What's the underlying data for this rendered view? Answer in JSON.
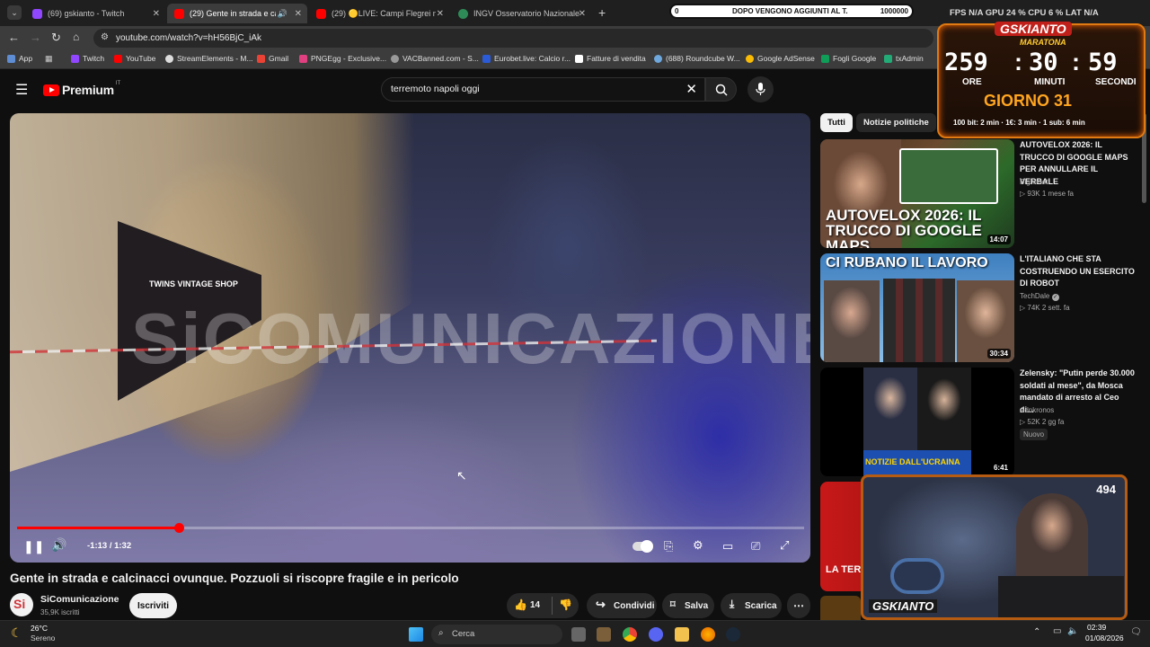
{
  "browser": {
    "tabs": [
      {
        "label": "(69) gskianto - Twitch",
        "color": "#9146ff",
        "active": false
      },
      {
        "label": "(29) Gente in strada e calcin",
        "color": "#ff0000",
        "active": true
      },
      {
        "label": "(29) 🟡LIVE: Campi Flegrei mo",
        "color": "#ff0000",
        "active": false
      },
      {
        "label": "INGV Osservatorio Nazionale Te",
        "color": "#2e8b57",
        "active": false
      }
    ],
    "new_tab": "+",
    "url": "youtube.com/watch?v=hH56BjC_iAk",
    "bookmarks": [
      {
        "label": "App",
        "color": "#5f8dd3"
      },
      {
        "label": "Twitch",
        "color": "#9146ff"
      },
      {
        "label": "YouTube",
        "color": "#ff0000"
      },
      {
        "label": "StreamElements - M...",
        "color": "#dddddd"
      },
      {
        "label": "Gmail",
        "color": "#ea4335"
      },
      {
        "label": "PNGEgg - Exclusive...",
        "color": "#e04080"
      },
      {
        "label": "VACBanned.com - S...",
        "color": "#999999"
      },
      {
        "label": "Eurobet.live: Calcio r...",
        "color": "#2b5bd7"
      },
      {
        "label": "Fatture di vendita",
        "color": "#ffffff"
      },
      {
        "label": "(688) Roundcube W...",
        "color": "#6fa8dc"
      },
      {
        "label": "Google AdSense",
        "color": "#fbbc05"
      },
      {
        "label": "Fogli Google",
        "color": "#0f9d58"
      },
      {
        "label": "txAdmin",
        "color": "#22aa77"
      }
    ]
  },
  "youtube": {
    "logo_text": "Premium",
    "logo_region": "IT",
    "search_query": "terremoto napoli oggi",
    "video": {
      "title": "Gente in strada e calcinacci ovunque. Pozzuoli si riscopre fragile e in pericolo",
      "time_display": "-1:13 / 1:32",
      "progress": 0.206,
      "watermark_text": "SiCOMUNICAZIONE",
      "shop_sign": "TWINS VINTAGE SHOP"
    },
    "channel": {
      "name": "SiComunicazione",
      "subscribers": "35,9K iscritti",
      "avatar_text": "Si",
      "subscribe_label": "Iscriviti"
    },
    "actions": {
      "likes": "14",
      "share": "Condividi",
      "save": "Salva",
      "download": "Scarica"
    },
    "chips": [
      "Tutti",
      "Notizie politiche"
    ],
    "recommendations": [
      {
        "title": "AUTOVELOX 2026: IL TRUCCO DI GOOGLE MAPS PER ANNULLARE IL VERBALE",
        "channel": "Bighenet",
        "meta": "▷ 93K  1 mese fa",
        "duration": "14:07",
        "thumb_text": "AUTOVELOX 2026: IL TRUCCO DI GOOGLE MAPS",
        "badge": ""
      },
      {
        "title": "L'ITALIANO CHE STA COSTRUENDO UN ESERCITO DI ROBOT",
        "channel": "TechDale",
        "meta": "▷ 74K  2 sett. fa",
        "duration": "30:34",
        "thumb_text": "CI RUBANO IL LAVORO",
        "badge": ""
      },
      {
        "title": "Zelensky: \"Putin perde 30.000 soldati al mese\", da Mosca mandato di arresto al Ceo di...",
        "channel": "Adnkronos",
        "meta": "▷ 52K  2 gg fa",
        "duration": "6:41",
        "thumb_text": "NOTIZIE DALL'UCRAINA",
        "badge": "Nuovo"
      },
      {
        "title": "",
        "channel": "",
        "meta": "",
        "duration": "",
        "thumb_text": "LA TERRA",
        "badge": ""
      }
    ]
  },
  "overlay": {
    "goal_left": "0",
    "goal_text": "DOPO VENGONO AGGIUNTI AL T.",
    "goal_right": "1000000",
    "stats": "FPS N/A   GPU 24 %   CPU 6 %   LAT N/A",
    "marathon_brand": "GSKIANTO",
    "marathon_label": "MARATONA",
    "hours": "259",
    "minutes": "30",
    "seconds": "59",
    "hours_label": "ORE",
    "minutes_label": "MINUTI",
    "seconds_label": "SECONDI",
    "day_label": "GIORNO 31",
    "rules": "100 bit: 2 min · 1€: 3 min · 1 sub: 6 min",
    "webcam_counter": "494",
    "webcam_brand": "GSKIANTO"
  },
  "taskbar": {
    "weather_temp": "26°C",
    "weather_desc": "Sereno",
    "search_placeholder": "Cerca",
    "time": "02:39",
    "date": "01/08/2026"
  },
  "colors": {
    "youtube_red": "#ff0000",
    "marathon_orange": "#e07a12"
  }
}
